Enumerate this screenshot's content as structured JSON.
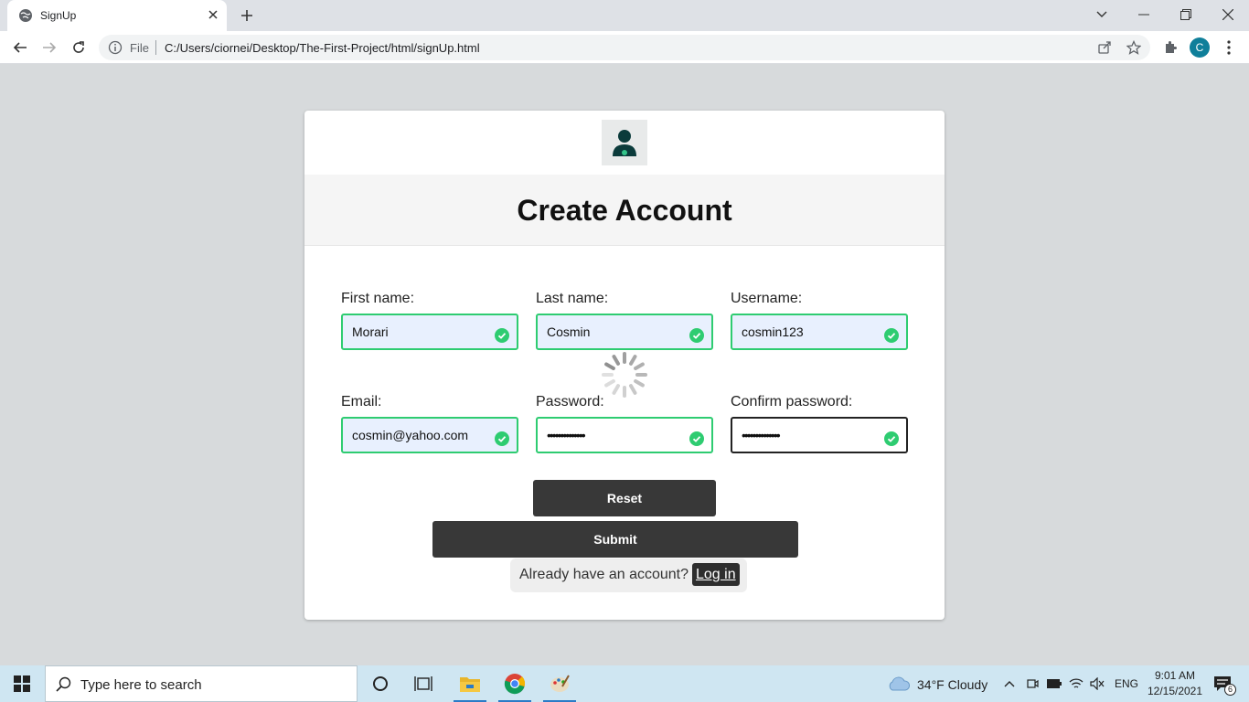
{
  "browser": {
    "tab_title": "SignUp",
    "address_scheme": "File",
    "address_url": "C:/Users/ciornei/Desktop/The-First-Project/html/signUp.html",
    "profile_initial": "C"
  },
  "form": {
    "title": "Create Account",
    "fields": [
      {
        "label": "First name:",
        "value": "Morari"
      },
      {
        "label": "Last name:",
        "value": "Cosmin"
      },
      {
        "label": "Username:",
        "value": "cosmin123"
      },
      {
        "label": "Email:",
        "value": "cosmin@yahoo.com"
      },
      {
        "label": "Password:",
        "value": "••••••••••••••"
      },
      {
        "label": "Confirm password:",
        "value": "••••••••••••••"
      }
    ],
    "reset_label": "Reset",
    "submit_label": "Submit",
    "login_prompt": "Already have an account?",
    "login_link": "Log in"
  },
  "taskbar": {
    "search_placeholder": "Type here to search",
    "weather": "34°F  Cloudy",
    "language": "ENG",
    "time": "9:01 AM",
    "date": "12/15/2021",
    "notifications": "6"
  },
  "colors": {
    "valid": "#2ecc71",
    "button": "#383838",
    "accent": "#0f7f9a"
  }
}
